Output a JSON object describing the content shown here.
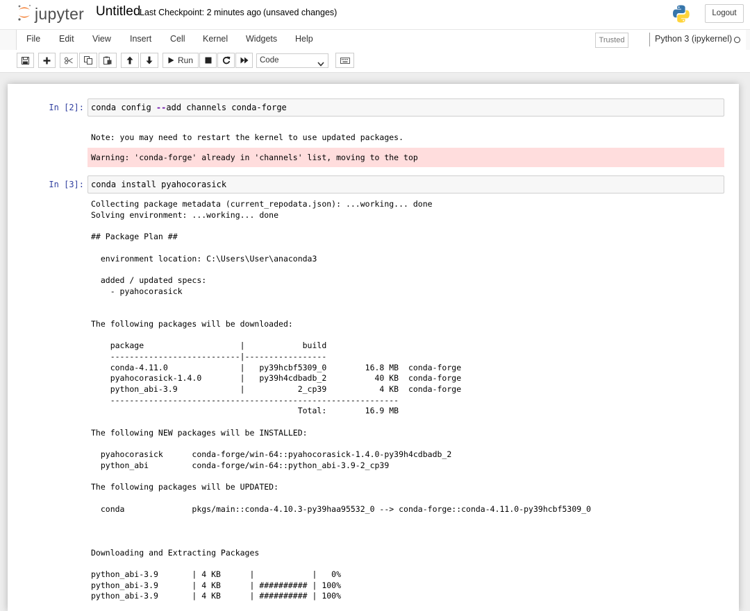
{
  "header": {
    "logo_text": "jupyter",
    "notebook_name": "Untitled",
    "checkpoint": "Last Checkpoint: 2 minutes ago",
    "save_status": "(unsaved changes)",
    "logout_label": "Logout"
  },
  "menubar": {
    "items": [
      "File",
      "Edit",
      "View",
      "Insert",
      "Cell",
      "Kernel",
      "Widgets",
      "Help"
    ],
    "trusted_label": "Trusted",
    "kernel_name": "Python 3 (ipykernel)"
  },
  "toolbar": {
    "buttons": [
      "save-icon",
      "plus-icon",
      "cut-icon",
      "copy-icon",
      "paste-icon",
      "arrow-up-icon",
      "arrow-down-icon",
      "run-icon",
      "stop-icon",
      "restart-icon",
      "fast-forward-icon",
      "keyboard-icon"
    ],
    "run_label": "Run",
    "cell_type": "Code"
  },
  "cells": [
    {
      "prompt": "In [2]:",
      "source_prefix": "conda config ",
      "source_op": "--",
      "source_suffix": "add channels conda-forge",
      "stdout": "Note: you may need to restart the kernel to use updated packages.",
      "stderr": "Warning: 'conda-forge' already in 'channels' list, moving to the top"
    },
    {
      "prompt": "In [3]:",
      "source": "conda install pyahocorasick",
      "stdout": "Collecting package metadata (current_repodata.json): ...working... done\nSolving environment: ...working... done\n\n## Package Plan ##\n\n  environment location: C:\\Users\\User\\anaconda3\n\n  added / updated specs:\n    - pyahocorasick\n\n\nThe following packages will be downloaded:\n\n    package                    |            build\n    ---------------------------|-----------------\n    conda-4.11.0               |   py39hcbf5309_0        16.8 MB  conda-forge\n    pyahocorasick-1.4.0        |   py39h4cdbadb_2          40 KB  conda-forge\n    python_abi-3.9             |           2_cp39           4 KB  conda-forge\n    ------------------------------------------------------------\n                                           Total:        16.9 MB\n\nThe following NEW packages will be INSTALLED:\n\n  pyahocorasick      conda-forge/win-64::pyahocorasick-1.4.0-py39h4cdbadb_2\n  python_abi         conda-forge/win-64::python_abi-3.9-2_cp39\n\nThe following packages will be UPDATED:\n\n  conda              pkgs/main::conda-4.10.3-py39haa95532_0 --> conda-forge::conda-4.11.0-py39hcbf5309_0\n\n\n\nDownloading and Extracting Packages\n\npython_abi-3.9       | 4 KB      |            |   0%\npython_abi-3.9       | 4 KB      | ########## | 100%\npython_abi-3.9       | 4 KB      | ########## | 100%"
    }
  ]
}
